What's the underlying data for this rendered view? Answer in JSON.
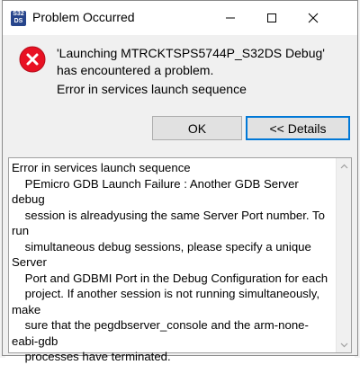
{
  "window": {
    "title": "Problem Occurred",
    "app_icon_text": "S32 DS"
  },
  "message": {
    "main": "'Launching MTRCKTSPS5744P_S32DS Debug' has encountered a problem.",
    "sub": "Error in services launch sequence"
  },
  "buttons": {
    "ok": "OK",
    "details": "<< Details"
  },
  "details": {
    "text": "Error in services launch sequence\n    PEmicro GDB Launch Failure : Another GDB Server debug\n    session is alreadyusing the same Server Port number. To run\n    simultaneous debug sessions, please specify a unique Server\n    Port and GDBMI Port in the Debug Configuration for each\n    project. If another session is not running simultaneously, make\n    sure that the pegdbserver_console and the arm-none-eabi-gdb\n    processes have terminated."
  },
  "colors": {
    "error_red": "#e81123",
    "accent_blue": "#0078d7",
    "dialog_bg": "#f0f0f0"
  },
  "icons": {
    "app": "s32ds-app-icon",
    "error": "error-icon",
    "minimize": "minimize-icon",
    "maximize": "maximize-icon",
    "close": "close-icon"
  }
}
